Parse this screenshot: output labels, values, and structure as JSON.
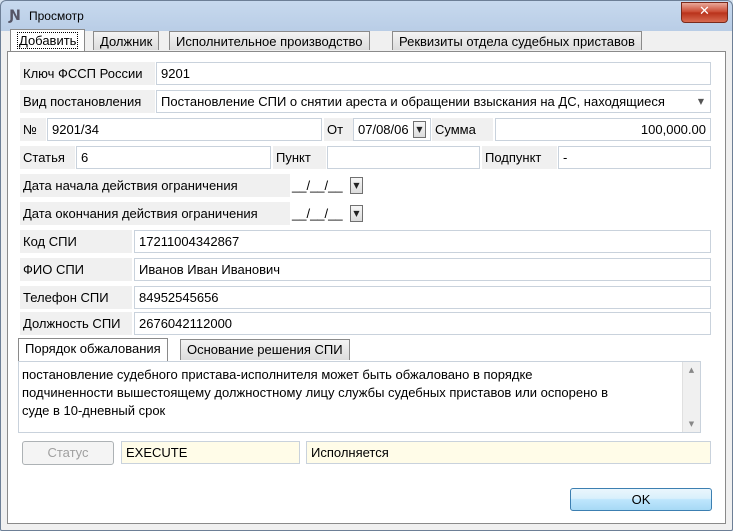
{
  "window": {
    "title": "Просмотр",
    "icon": "app-icon",
    "close_label": "✕"
  },
  "tabs": [
    "Добавить",
    "Должник",
    "Исполнительное производство",
    "Реквизиты отдела судебных приставов"
  ],
  "form": {
    "key_label": "Ключ ФССП России",
    "key_value": "9201",
    "order_type_label": "Вид постановления",
    "order_type_value": "Постановление СПИ о снятии ареста и обращении взыскания на ДС, находящиеся",
    "number_label": "№",
    "number_value": "9201/34",
    "from_label": "От",
    "from_value": "07/08/06",
    "sum_label": "Сумма",
    "sum_value": "100,000.00",
    "article_label": "Статья",
    "article_value": "6",
    "point_label": "Пункт",
    "point_value": "",
    "subpoint_label": "Подпункт",
    "subpoint_value": "-",
    "restr_start_label": "Дата начала действия ограничения",
    "restr_start_value": "__/__/__",
    "restr_end_label": "Дата окончания действия ограничения",
    "restr_end_value": "__/__/__",
    "spi_code_label": "Код СПИ",
    "spi_code_value": "17211004342867",
    "spi_name_label": "ФИО СПИ",
    "spi_name_value": "Иванов Иван Иванович",
    "spi_phone_label": "Телефон СПИ",
    "spi_phone_value": "84952545656",
    "spi_position_label": "Должность СПИ",
    "spi_position_value": "2676042112000"
  },
  "inner_tabs": [
    "Порядок обжалования",
    "Основание решения СПИ"
  ],
  "appeal_text": "постановление судебного пристава-исполнителя может быть обжаловано в порядке\nподчиненности вышестоящему должностному лицу службы судебных приставов или оспорено в\nсуде в 10-дневный срок",
  "status": {
    "button_label": "Статус",
    "code": "EXECUTE",
    "text": "Исполняется"
  },
  "ok_label": "OK",
  "icons": {
    "dropdown": "▼",
    "scroll_up": "▲",
    "scroll_down": "▼"
  }
}
